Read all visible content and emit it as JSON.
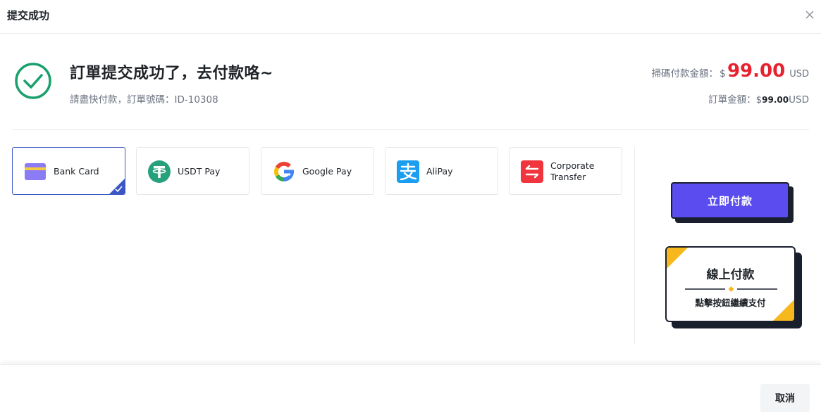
{
  "header": {
    "title": "提交成功",
    "close_icon": "close-icon"
  },
  "summary": {
    "title": "訂單提交成功了，去付款咯~",
    "subtitle": "請盡快付款，訂單號碼：ID-10308",
    "icon": "success-check-icon",
    "accent_color": "#1aa06d"
  },
  "amounts": {
    "scan_label": "掃碼付款金額：",
    "scan_currency_symbol": "$",
    "scan_value": "99.00",
    "scan_unit": "USD",
    "scan_color": "#e8212f",
    "order_label": "訂單金額：",
    "order_currency_symbol": "$",
    "order_value": "99.00",
    "order_unit": "USD"
  },
  "payment_methods": [
    {
      "label": "Bank Card",
      "icon": "bank-card-icon",
      "selected": true
    },
    {
      "label": "USDT Pay",
      "icon": "usdt-icon",
      "selected": false
    },
    {
      "label": "Google Pay",
      "icon": "google-icon",
      "selected": false
    },
    {
      "label": "AliPay",
      "icon": "alipay-icon",
      "selected": false
    },
    {
      "label": "Corporate Transfer",
      "icon": "transfer-icon",
      "selected": false
    }
  ],
  "actions": {
    "pay_now_label": "立即付款",
    "pay_now_color": "#5b4cf0",
    "online_title": "線上付款",
    "online_subtitle": "點擊按鈕繼續支付",
    "online_accent": "#f6b81c"
  },
  "footer": {
    "cancel_label": "取消"
  }
}
